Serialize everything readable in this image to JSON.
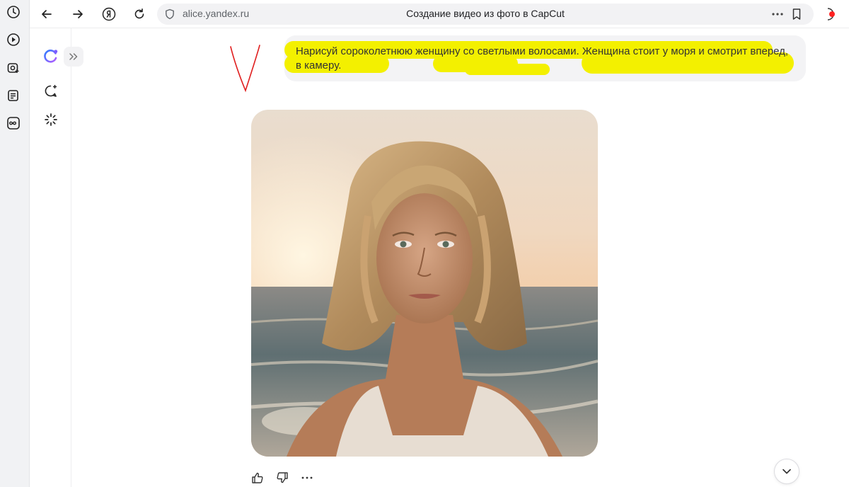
{
  "browser": {
    "url": "alice.yandex.ru",
    "tab_title": "Создание видео из фото в CapCut",
    "left_rail_icons": [
      "history-icon",
      "video-icon",
      "screenshot-icon",
      "notes-icon",
      "infinity-icon"
    ],
    "recording_color": "#ff2222"
  },
  "sidebar": {
    "icons": [
      "alice-logo-icon",
      "expand-chevrons-icon",
      "new-chat-icon",
      "sparkle-loading-icon"
    ],
    "accent_color": "#7a5cff"
  },
  "chat": {
    "user_message": "Нарисуй сороколетнюю женщину со светлыми волосами. Женщина стоит у моря и смотрит вперед, в камеру.",
    "highlight_color": "#f3f000",
    "annotation_color": "#e02020",
    "image_subject": "photo-of-woman-at-sea"
  },
  "actions": {
    "icons": [
      "thumbs-up-icon",
      "thumbs-down-icon",
      "more-dots-icon",
      "scroll-down-icon"
    ]
  }
}
